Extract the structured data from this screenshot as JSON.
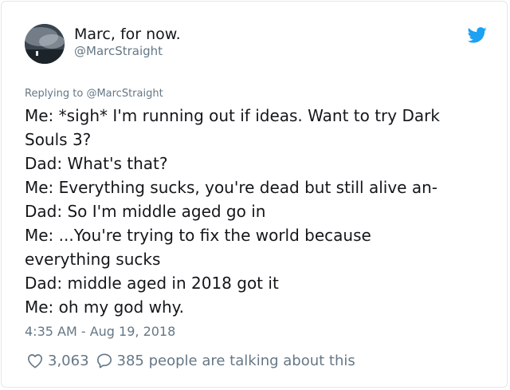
{
  "author": {
    "display_name": "Marc, for now.",
    "handle": "@MarcStraight",
    "avatar_icon": "avatar-image"
  },
  "brand": {
    "icon": "twitter-bird-icon",
    "color": "#1da1f2"
  },
  "reply": {
    "prefix": "Replying to",
    "handle": "@MarcStraight"
  },
  "tweet": {
    "lines": [
      "Me: *sigh* I'm running out if ideas. Want to try Dark",
      "Souls 3?",
      "Dad: What's that?",
      "Me: Everything sucks, you're dead but still alive an-",
      "Dad: So I'm middle aged go in",
      "Me: ...You're trying to fix the world because",
      "everything sucks",
      "Dad: middle aged in 2018 got it",
      "Me: oh my god why."
    ]
  },
  "timestamp": "4:35 AM - Aug 19, 2018",
  "engagement": {
    "likes": "3,063",
    "like_icon": "heart-icon",
    "comment_icon": "speech-bubble-icon",
    "talking_text": "385 people are talking about this"
  },
  "colors": {
    "text": "#14171a",
    "muted": "#657786",
    "border": "#e1e8ed"
  }
}
